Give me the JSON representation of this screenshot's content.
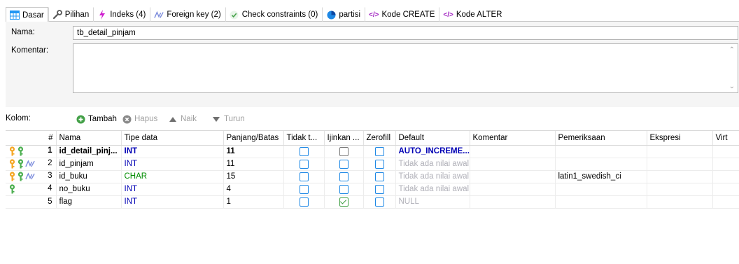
{
  "tabs": [
    {
      "label": "Dasar",
      "icon": "table-icon"
    },
    {
      "label": "Pilihan",
      "icon": "wrench-icon"
    },
    {
      "label": "Indeks (4)",
      "icon": "lightning-icon"
    },
    {
      "label": "Foreign key (2)",
      "icon": "foreign-key-icon"
    },
    {
      "label": "Check constraints (0)",
      "icon": "check-icon"
    },
    {
      "label": "partisi",
      "icon": "pie-icon"
    },
    {
      "label": "Kode CREATE",
      "icon": "code-icon"
    },
    {
      "label": "Kode ALTER",
      "icon": "code-icon"
    }
  ],
  "form": {
    "name_label": "Nama:",
    "name_value": "tb_detail_pinjam",
    "comment_label": "Komentar:",
    "comment_value": ""
  },
  "toolbar": {
    "columns_label": "Kolom:",
    "add_label": "Tambah",
    "delete_label": "Hapus",
    "up_label": "Naik",
    "down_label": "Turun"
  },
  "table": {
    "headers": [
      "#",
      "Nama",
      "Tipe data",
      "Panjang/Batas",
      "Tidak t...",
      "Ijinkan ...",
      "Zerofill",
      "Default",
      "Komentar",
      "Pemeriksaan",
      "Ekspresi",
      "Virt"
    ],
    "rows": [
      {
        "num": "1",
        "name": "id_detail_pinj...",
        "type": "INT",
        "length": "11",
        "unsigned": false,
        "nullable": false,
        "zerofill": false,
        "default": "AUTO_INCREME...",
        "comment": "",
        "collation": "",
        "expression": "",
        "keys": [
          "primary-key",
          "unique-key"
        ],
        "bold": true
      },
      {
        "num": "2",
        "name": "id_pinjam",
        "type": "INT",
        "length": "11",
        "unsigned": false,
        "nullable": false,
        "zerofill": false,
        "default": "Tidak ada nilai awal",
        "comment": "",
        "collation": "",
        "expression": "",
        "keys": [
          "primary-key",
          "key",
          "foreign-key"
        ],
        "bold": false
      },
      {
        "num": "3",
        "name": "id_buku",
        "type": "CHAR",
        "length": "15",
        "unsigned": false,
        "nullable": false,
        "zerofill": false,
        "default": "Tidak ada nilai awal",
        "comment": "",
        "collation": "latin1_swedish_ci",
        "expression": "",
        "keys": [
          "primary-key",
          "key",
          "foreign-key"
        ],
        "bold": false
      },
      {
        "num": "4",
        "name": "no_buku",
        "type": "INT",
        "length": "4",
        "unsigned": false,
        "nullable": false,
        "zerofill": false,
        "default": "Tidak ada nilai awal",
        "comment": "",
        "collation": "",
        "expression": "",
        "keys": [
          "key"
        ],
        "bold": false
      },
      {
        "num": "5",
        "name": "flag",
        "type": "INT",
        "length": "1",
        "unsigned": false,
        "nullable": true,
        "zerofill": false,
        "default": "NULL",
        "comment": "",
        "collation": "",
        "expression": "",
        "keys": [],
        "bold": false
      }
    ]
  },
  "colors": {
    "primary_key": "#f5a623",
    "key": "#4caf50",
    "type_int": "#0000b4",
    "type_char": "#008c00",
    "checkbox_blue": "#1e88e5",
    "checkbox_green": "#43a047"
  }
}
